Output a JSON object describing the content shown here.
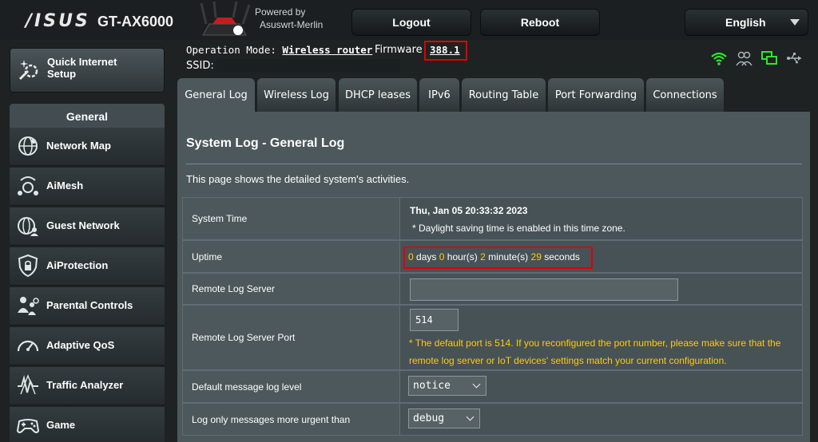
{
  "header": {
    "brand": "/ISUS",
    "model": "GT-AX6000",
    "powered_by_line1": "Powered by",
    "powered_by_line2": "Asuswrt-Merlin",
    "logout_label": "Logout",
    "reboot_label": "Reboot",
    "language": "English"
  },
  "status": {
    "operation_mode_label": "Operation Mode:",
    "operation_mode_value": "Wireless router",
    "firmware_label": "Firmware",
    "firmware_value": "388.1",
    "ssid_label": "SSID:",
    "icons": [
      "wifi-icon",
      "clients-icon",
      "network-icon",
      "usb-icon"
    ]
  },
  "sidebar": {
    "quick_setup": "Quick Internet Setup",
    "general_header": "General",
    "items": [
      {
        "label": "Network Map",
        "icon": "globe-icon"
      },
      {
        "label": "AiMesh",
        "icon": "aimesh-icon"
      },
      {
        "label": "Guest Network",
        "icon": "guest-network-icon"
      },
      {
        "label": "AiProtection",
        "icon": "shield-lock-icon"
      },
      {
        "label": "Parental Controls",
        "icon": "parental-controls-icon"
      },
      {
        "label": "Adaptive QoS",
        "icon": "gauge-icon"
      },
      {
        "label": "Traffic Analyzer",
        "icon": "traffic-analyzer-icon"
      },
      {
        "label": "Game",
        "icon": "gamepad-icon"
      }
    ]
  },
  "tabs": [
    {
      "label": "General Log",
      "active": true
    },
    {
      "label": "Wireless Log",
      "active": false
    },
    {
      "label": "DHCP leases",
      "active": false
    },
    {
      "label": "IPv6",
      "active": false
    },
    {
      "label": "Routing Table",
      "active": false
    },
    {
      "label": "Port Forwarding",
      "active": false
    },
    {
      "label": "Connections",
      "active": false
    }
  ],
  "main": {
    "title": "System Log - General Log",
    "description": "This page shows the detailed system's activities.",
    "system_time_label": "System Time",
    "system_time_value": "Thu, Jan 05 20:33:32 2023",
    "system_time_note": "* Daylight saving time is enabled in this time zone.",
    "uptime_label": "Uptime",
    "uptime": {
      "days": "0",
      "hours": "0",
      "minutes": "2",
      "seconds": "29",
      "days_unit": "days",
      "hours_unit": "hour(s)",
      "minutes_unit": "minute(s)",
      "seconds_unit": "seconds"
    },
    "remote_log_server_label": "Remote Log Server",
    "remote_log_server_value": "",
    "remote_port_label": "Remote Log Server Port",
    "remote_port_value": "514",
    "remote_port_note": "* The default port is 514. If you reconfigured the port number, please make sure that the remote log server or IoT devices' settings match your current configuration.",
    "default_level_label": "Default message log level",
    "default_level_value": "notice",
    "urgent_label": "Log only messages more urgent than",
    "urgent_value": "debug"
  },
  "colors": {
    "accent_yellow": "#ffcc00",
    "highlight_red": "#e00000",
    "panel": "#4d585c"
  }
}
